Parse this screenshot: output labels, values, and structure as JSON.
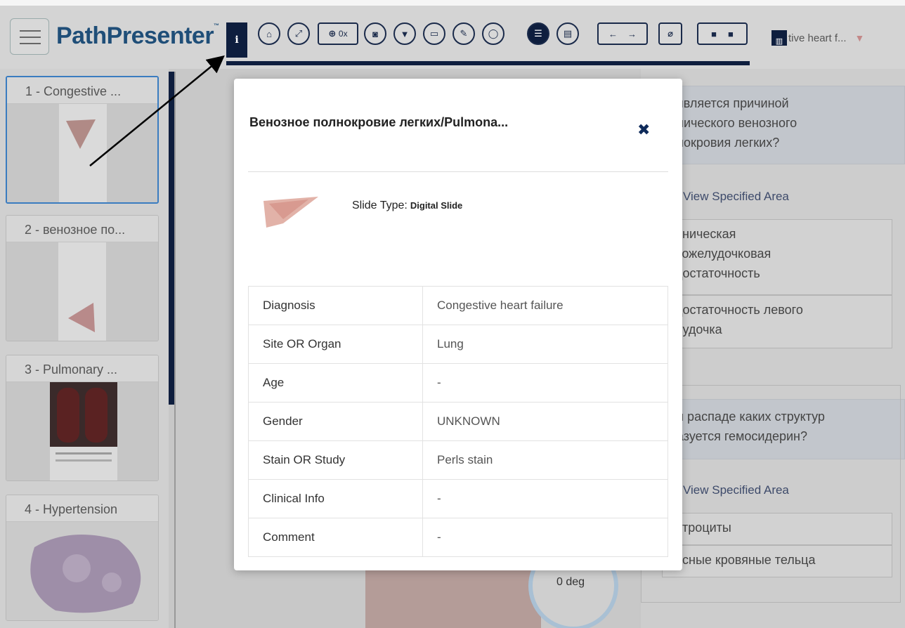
{
  "app": {
    "logo": "PathPresenter",
    "logo_tm": "™",
    "tab_title": "tive heart f..."
  },
  "toolbar": {
    "info_label": "i",
    "zoom_label": "0x",
    "icons": [
      "home-icon",
      "fullscreen-icon",
      "zoom-icon",
      "camera-icon",
      "filter-icon",
      "comment-icon",
      "pen-icon",
      "circle-icon",
      "list-icon",
      "document-icon",
      "prev-arrow-icon",
      "next-arrow-icon",
      "paperclip-icon",
      "video-icon",
      "stop-icon",
      "chart-icon",
      "funnel-icon"
    ]
  },
  "sidebar": {
    "slides": [
      {
        "label": "1 - Congestive ..."
      },
      {
        "label": "2 - венозное по..."
      },
      {
        "label": "3 - Pulmonary ..."
      },
      {
        "label": "4 - Hypertension"
      }
    ]
  },
  "viewer": {
    "rotation": "0 deg"
  },
  "questions": {
    "q1": {
      "text_lines": [
        "является причиной",
        "нического венозного",
        "нокровия легких?"
      ],
      "link": "View Specified Area",
      "options": [
        [
          "оническая",
          "вожелудочковая",
          "достаточность"
        ],
        [
          "достаточность левого",
          "лудочка"
        ]
      ]
    },
    "q2": {
      "text_lines": [
        "и распаде каких структур",
        "азуется гемосидерин?"
      ],
      "link": "View Specified Area",
      "options": [
        [
          "итроциты"
        ],
        [
          "асные кровяные тельца"
        ]
      ]
    }
  },
  "modal": {
    "title": "Венозное полнокровие легких/Pulmona...",
    "close": "✖",
    "slide_type_label": "Slide Type:",
    "slide_type_value": "Digital Slide",
    "rows": [
      {
        "key": "Diagnosis",
        "value": "Congestive heart failure"
      },
      {
        "key": "Site OR Organ",
        "value": "Lung"
      },
      {
        "key": "Age",
        "value": "-"
      },
      {
        "key": "Gender",
        "value": "UNKNOWN"
      },
      {
        "key": "Stain OR Study",
        "value": "Perls stain"
      },
      {
        "key": "Clinical Info",
        "value": "-"
      },
      {
        "key": "Comment",
        "value": "-"
      }
    ]
  }
}
